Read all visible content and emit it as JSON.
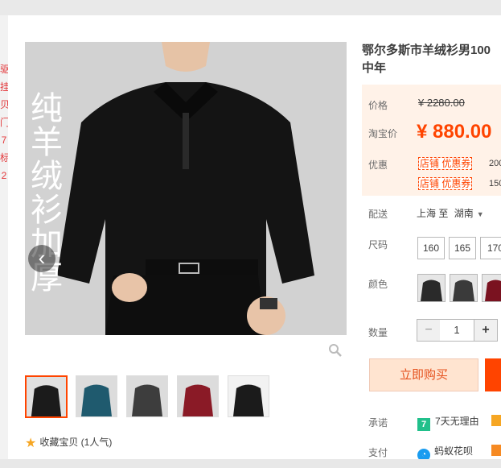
{
  "product": {
    "title_line1": "鄂尔多斯市羊绒衫男100",
    "title_line2": "中年",
    "image_overlay_text": "纯羊绒衫加厚"
  },
  "price": {
    "original_label": "价格",
    "original_value": "¥ 2280.00",
    "taobao_label": "淘宝价",
    "taobao_value": "¥ 880.00"
  },
  "promotion": {
    "label": "优惠",
    "coupons": [
      {
        "tag": "店铺 优惠券",
        "amount": "200"
      },
      {
        "tag": "店铺 优惠券",
        "amount": "150"
      }
    ]
  },
  "shipping": {
    "label": "配送",
    "from": "上海 至",
    "to": "湖南"
  },
  "sizes": {
    "label": "尺码",
    "options": [
      "160",
      "165",
      "170"
    ]
  },
  "colors": {
    "label": "颜色",
    "swatches": [
      "#2a2a2a",
      "#3a3a3a",
      "#7a1220"
    ]
  },
  "quantity": {
    "label": "数量",
    "value": "1",
    "minus": "−",
    "plus": "+"
  },
  "actions": {
    "buy_now": "立即购买"
  },
  "promise": {
    "label": "承诺",
    "badge": "7",
    "text": "7天无理由"
  },
  "payment": {
    "label": "支付",
    "method": "蚂蚁花呗"
  },
  "favorite": {
    "text": "收藏宝贝 (1人气)"
  },
  "thumbnails": [
    {
      "color": "#1b1b1b"
    },
    {
      "color": "#1f5a6e"
    },
    {
      "color": "#3d3d3d"
    },
    {
      "color": "#8a1a26"
    },
    {
      "color": "#1b1b1b"
    }
  ],
  "sidebar_fragments": [
    "驱",
    "挂",
    "贝",
    "门",
    "7",
    "标",
    "2"
  ]
}
